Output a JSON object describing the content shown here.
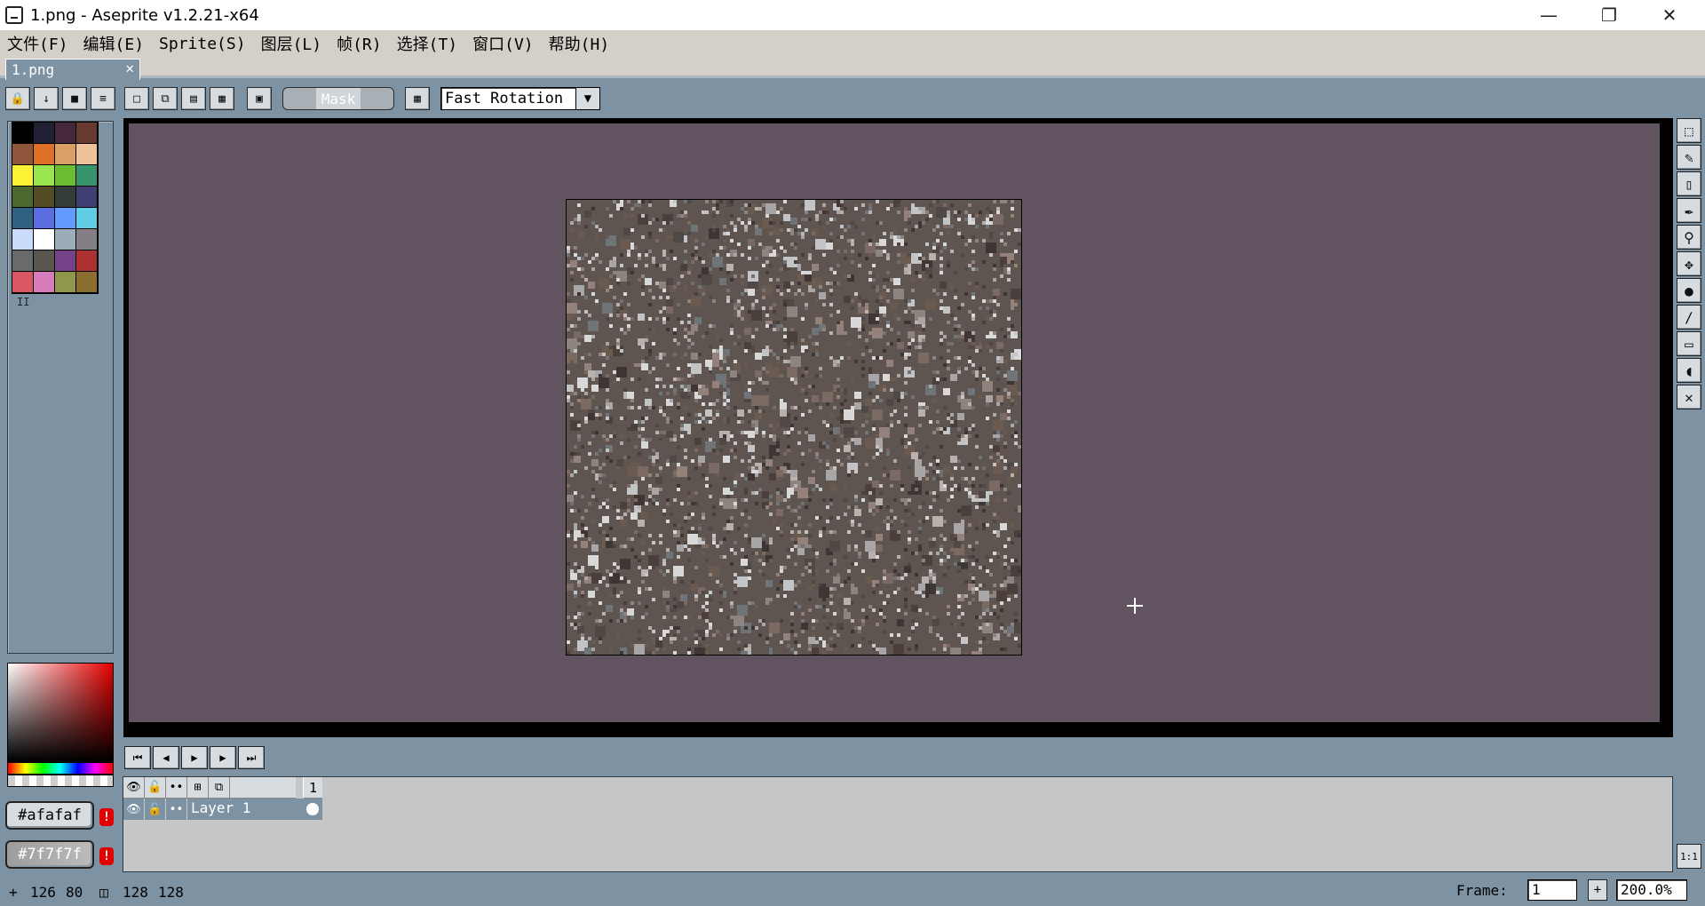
{
  "window": {
    "title": "1.png - Aseprite v1.2.21-x64",
    "minimize_icon": "minimize-icon",
    "maximize_icon": "restore-icon",
    "close_icon": "close-icon"
  },
  "menubar": {
    "items": [
      "文件(F)",
      "编辑(E)",
      "Sprite(S)",
      "图层(L)",
      "帧(R)",
      "选择(T)",
      "窗口(V)",
      "帮助(H)"
    ]
  },
  "tabs": [
    {
      "label": "1.png",
      "close": "✕"
    }
  ],
  "toolbar": {
    "mask_label": "Mask",
    "rotation_algorithm": "Fast Rotation"
  },
  "palette": {
    "colors": [
      "#000000",
      "#222034",
      "#45283c",
      "#663931",
      "#8f563b",
      "#df7126",
      "#d9a066",
      "#eec39a",
      "#fbf236",
      "#99e550",
      "#6abe30",
      "#37946e",
      "#4b692f",
      "#524b24",
      "#323c39",
      "#3f3f74",
      "#306082",
      "#5b6ee1",
      "#639bff",
      "#5fcde4",
      "#cbdbfc",
      "#ffffff",
      "#9badb7",
      "#847e87",
      "#696a6a",
      "#595652",
      "#76428a",
      "#ac3232",
      "#d95763",
      "#d77bba",
      "#8f974a",
      "#8a6f30"
    ],
    "handle": "II"
  },
  "colors": {
    "foreground": "#afafaf",
    "background": "#7f7f7f",
    "warning": "!",
    "ui_bg": "#7d93a4",
    "canvas_bg": "#625360"
  },
  "tools": [
    "rectangular-marquee-icon",
    "pencil-icon",
    "eraser-icon",
    "eyedropper-icon",
    "zoom-icon",
    "move-icon",
    "paint-bucket-icon",
    "line-icon",
    "rectangle-icon",
    "contour-icon",
    "blur-icon"
  ],
  "timeline": {
    "frame_header": "1",
    "layers": [
      {
        "name": "Layer 1"
      }
    ]
  },
  "status": {
    "cursor_x": "126",
    "cursor_y": "80",
    "sprite_w": "128",
    "sprite_h": "128",
    "frame_label": "Frame:",
    "frame_value": "1",
    "frame_plus": "+",
    "zoom": "200.0%",
    "zoom_fit": "1:1"
  }
}
